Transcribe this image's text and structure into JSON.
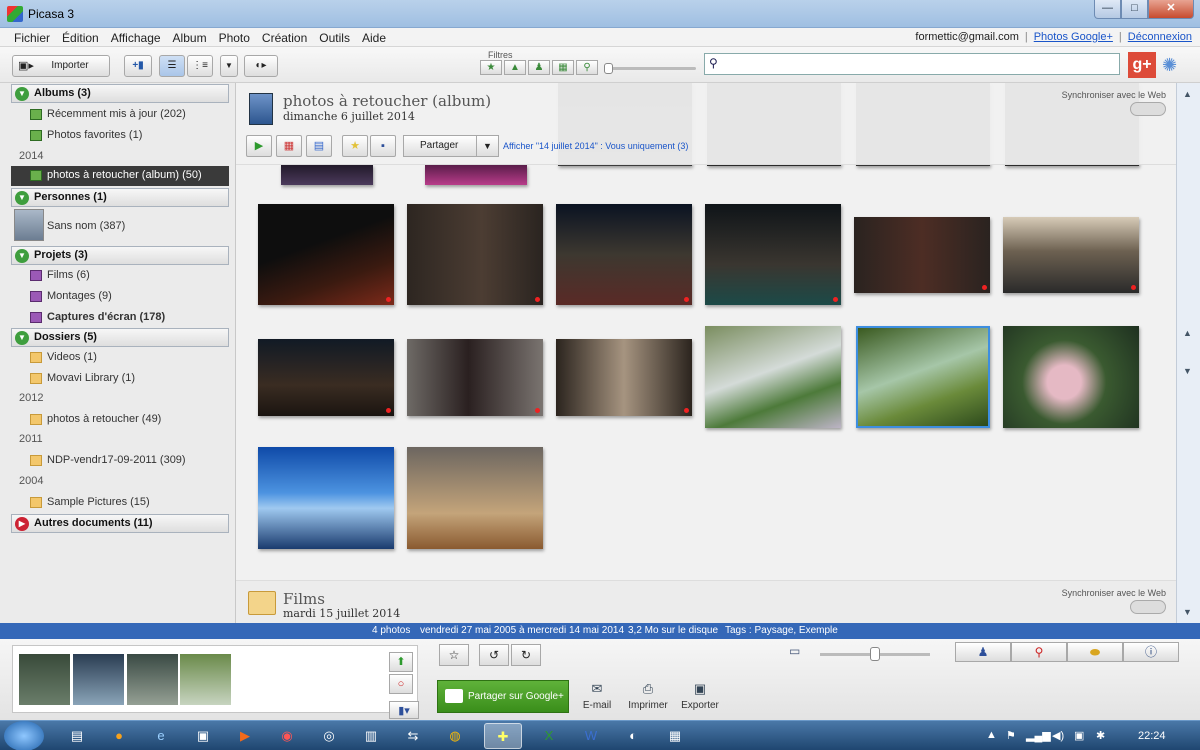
{
  "window": {
    "title": "Picasa 3",
    "min": "—",
    "max": "□",
    "close": "✕"
  },
  "menu": {
    "items": [
      "Fichier",
      "Édition",
      "Affichage",
      "Album",
      "Photo",
      "Création",
      "Outils",
      "Aide"
    ]
  },
  "account": {
    "email": "formettic@gmail.com",
    "photos_link": "Photos Google+",
    "logout": "Déconnexion",
    "sep": "|"
  },
  "toolbar": {
    "import_label": "Importer",
    "filters_label": "Filtres",
    "search_placeholder": "",
    "gplus": "g+"
  },
  "sidebar": {
    "albums": {
      "label": "Albums (3)",
      "items": [
        "Récemment mis à jour (202)",
        "Photos favorites (1)"
      ],
      "year": "2014",
      "selected": "photos à retoucher (album) (50)"
    },
    "people": {
      "label": "Personnes (1)",
      "items": [
        "Sans nom (387)"
      ]
    },
    "projects": {
      "label": "Projets (3)",
      "items": [
        "Films (6)",
        "Montages (9)",
        "Captures d'écran (178)"
      ]
    },
    "folders": {
      "label": "Dossiers (5)",
      "items": [
        "Videos (1)",
        "Movavi Library (1)"
      ],
      "y2012": "2012",
      "f2012": "photos à retoucher (49)",
      "y2011": "2011",
      "f2011": "NDP-vendr17-09-2011 (309)",
      "y2004": "2004",
      "f2004": "Sample Pictures (15)"
    },
    "others": {
      "label": "Autres documents (11)"
    }
  },
  "album": {
    "title": "photos à retoucher (album)",
    "date": "dimanche 6 juillet 2014",
    "sync_label": "Synchroniser avec le Web",
    "share_label": "Partager",
    "afficher": "Afficher \"14 juillet 2014\" : Vous uniquement (3)"
  },
  "films": {
    "title": "Films",
    "date": "mardi 15 juillet 2014",
    "sync_label": "Synchroniser avec le Web"
  },
  "status": {
    "count": "4 photos",
    "dates": "vendredi 27 mai 2005 à mercredi 14 mai 2014",
    "size": "3,2 Mo sur le disque",
    "tags": "Tags : Paysage, Exemple"
  },
  "tray": {
    "share_google": "Partager sur Google+",
    "email": "E-mail",
    "print": "Imprimer",
    "export": "Exporter"
  },
  "taskbar": {
    "clock": "22:24"
  },
  "colors": {
    "accent": "#3568b8",
    "selected_bg": "#3a3a3a",
    "share_green": "#4aa02c"
  }
}
